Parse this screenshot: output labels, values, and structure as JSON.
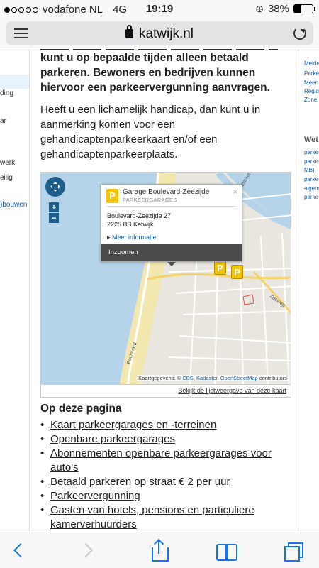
{
  "status": {
    "carrier": "vodafone NL",
    "network": "4G",
    "time": "19:19",
    "battery_pct": "38%",
    "battery_level": 0.38
  },
  "browser": {
    "url": "katwijk.nl"
  },
  "left_nav": [
    "ding",
    "ar",
    "werk",
    "eilig",
    ")bouwen"
  ],
  "right_nav": {
    "items_top": [
      "Melde",
      "Parke",
      "Meeri",
      "Regio",
      "Zone"
    ],
    "heading": "Wet",
    "items_bottom": [
      "parke",
      "parke",
      "MB)",
      "parke",
      "algem",
      "parke"
    ]
  },
  "content": {
    "bold_intro": "kunt u op bepaalde tijden alleen betaald parkeren. Bewoners en bedrijven kunnen hiervoor een parkeervergunning aanvragen.",
    "paragraph": "Heeft u een lichamelijk handicap, dan kunt u in aanmerking komen voor een gehandicaptenparkeerkaart en/of een gehandicaptenparkeerplaats."
  },
  "map": {
    "popup": {
      "title": "Garage Boulevard-Zeezijde",
      "category": "PARKEERGARAGES",
      "address_line1": "Boulevard-Zeezijde 27",
      "address_line2": "2225 BB Katwijk",
      "more_info": "Meer informatie",
      "zoom_button": "Inzoomen",
      "close": "×"
    },
    "zoom_in": "+",
    "zoom_out": "−",
    "marker_label": "P",
    "street_labels": [
      "Boulevard",
      "Zeeweg",
      "aalstraat"
    ],
    "attribution_prefix": "Kaartgegevens: ©",
    "attribution_links": [
      "CBS",
      "Kadaster",
      "OpenStreetMap"
    ],
    "attribution_suffix": "contributors",
    "list_link": "Bekijk de lijstweergave van deze kaart"
  },
  "on_page": {
    "heading": "Op deze pagina",
    "links": [
      "Kaart parkeergarages en -terreinen",
      "Openbare parkeergarages",
      "Abonnementen openbare parkeergarages voor auto's",
      "Betaald parkeren op straat € 2 per uur",
      "Parkeervergunning",
      "Gasten van hotels, pensions en particuliere kamerverhuurders"
    ]
  },
  "colors": {
    "link_blue": "#1a5b9e",
    "ios_blue": "#1476f2",
    "marker_yellow": "#f1c40f",
    "sea": "#b5d4e9",
    "beach": "#f3e7b0"
  }
}
